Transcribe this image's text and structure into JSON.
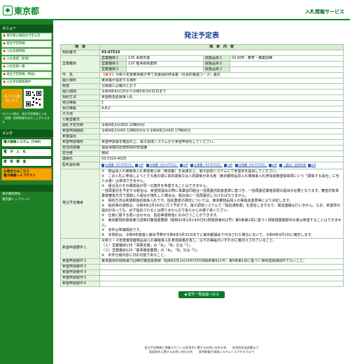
{
  "header": {
    "logo_glyph": "◆",
    "logo_text": "東京都",
    "service": "入札情報サービス"
  },
  "sidebar": {
    "menu_head": "メニュー",
    "items": [
      {
        "label": "東京都公報発注予定公告"
      },
      {
        "label": "発注予定情報"
      },
      {
        "label": "入札結果情報"
      },
      {
        "label": "入札情報（新規）"
      },
      {
        "label": "入札結果一覧"
      },
      {
        "label": "発注予定情報（物品）"
      },
      {
        "label": "入札参加資格要件"
      }
    ],
    "mobile_label": "モバイル版",
    "mobile_sub": "はこちら",
    "mobile_note": "モバイル版は、発注予定情報と入札（見積）結果情報を見ることができます",
    "link_head": "リンク",
    "banners": [
      {
        "label": "電子調達システム（TOP）"
      },
      {
        "label": "電　子　入　札"
      },
      {
        "label": "資　格　審　査"
      },
      {
        "label": "お問合せはこちら"
      }
    ],
    "banner_sub": "電子調達ヘルプデスク",
    "links": [
      "東京都財務局",
      "東京都トップページ"
    ]
  },
  "main": {
    "title": "発注予定表",
    "table_head": {
      "item": "項　目",
      "content": "項　目　内　容"
    },
    "rows": {
      "contract_no": {
        "label": "契約番号",
        "value": "03-07515"
      },
      "business_type": {
        "label": "営業種目",
        "entries": [
          {
            "label": "営業種目１",
            "value": "135 事務支援"
          },
          {
            "label": "営業種目２",
            "value": "120 催事関係業務"
          },
          {
            "label": "営業種目３",
            "value": ""
          }
        ],
        "categories": [
          {
            "label": "取扱品目１",
            "value": "02 研修・教育・職業訓練"
          },
          {
            "label": "取扱品目２",
            "value": ""
          },
          {
            "label": "取扱品目３",
            "value": ""
          }
        ]
      },
      "subject": {
        "label": "件　名",
        "tag": "【電子】",
        "value": "令和４年度東京都子育て支援員研修事業（社会的養護コース）委託"
      },
      "location": {
        "label": "履行場所",
        "value": "東京都が指定する場所"
      },
      "summary": {
        "label": "概要",
        "value": "仕様書に記載のとおり"
      },
      "period": {
        "label": "履行期間",
        "value": "令和4年4月1日から令和5年3月31日まで"
      },
      "method": {
        "label": "契約方法",
        "value": "希望制指名競争入札"
      },
      "dept": {
        "label": "発注等級",
        "value": "C"
      },
      "ranks": {
        "label": "受付等級",
        "value": "A,B,C"
      },
      "other": {
        "label": "その他",
        "value": ""
      },
      "announce": {
        "label": "公報登載日",
        "value": ""
      },
      "open_date": {
        "label": "開札予定日時",
        "value": "令和4年2月28日 10時00分"
      },
      "apply_period": {
        "label": "希望申請期間",
        "value": "令和4年2月4日 10時00分から令和4年2月9日 17時00分"
      },
      "apply_status": {
        "label": "希望提出",
        "value": ""
      },
      "apply_method": {
        "label": "希望申請場所",
        "value": "希望申請書を確認の上、電子調達システムから希望申請をしてください。"
      },
      "office": {
        "label": "担当局部課",
        "value": "福祉保健局総務部契約管理課"
      },
      "person": {
        "label": "担当者",
        "value": "徳岡"
      },
      "contact": {
        "label": "連絡先",
        "value": "03-5320-4025"
      },
      "attachments": {
        "label": "配布資料等",
        "files": [
          "仕様書（03-07515）",
          "pdf",
          "仕様書（03-07515）",
          "pdf",
          "仕様書（03-07515）",
          "pdf",
          "仕様書（03-07515）",
          "pdf",
          "（委託）契約約款",
          "pdf"
        ]
      },
      "remarks": {
        "label": "発注予定備考",
        "lines": [
          "①　物品買入れ等競争入札参加者心得（東京都）を承諾の上、電子調達システムにて希望票を提出してください。",
          "②　この入札に参加しようとする者の間に資本関係又は人的関係がある者（東京都物品買入れ等競争入札参加資格登録事項にいう「関係する会社」に当たる者）は参加できません。",
          "③　組合及びその構成員が同一の案件を希望することはできません。",
          "一括再委託を予定する組合は、希望票提出の際に事業協同組合一括再委託取扱基準に基づき、一括再委託業者調書の提出が必要となります。審査対象事業者審査方式で登録した組合が落札した場合は、組合員に一括再委託しなければなりません。",
          "※　契約方法は希望制指名競争入札です。指名業者の選定については、東京都物品買入れ等指名基準等により決定します。",
          "④　指名等の通知は、令和4年2月16日に行う予定です。電子調達システムで「指名通知書」を送信しますので、電話連絡は行いません。なお、希望票の提出があっても、必ず指名されるとは限りませんのであらかじめ御了承ください。",
          "⑤　仕様に関する問い合わせは、指名等通知後にのみ行うことができます。",
          "⑥　東京都契約関係暴力団等対策措置要綱（昭和62年1月14日付61財経庶第922号）第5条第1項に基づく排除措置期間中の者は希望することはできません。",
          "⑦　本件は単価契約です。",
          "⑧　本契約は、令和4年度歳入歳出予算が令和4年3月31日までに東京都議会で可決された場合において、令和4年4月1日に確定します。"
        ]
      },
      "requirement1": {
        "label": "希望申請要件１",
        "lines": [
          "令和３・４年度東京都物品買入れ等競争入札参加資格を有し、以下の等級のいずれかに格付けされていること。",
          "（１）営業種目135「事務支援」の「A」、「B」又は「C」",
          "（２）営業種目120「催事関係業務」の「A」、「B」又は「C」",
          "※　本件仕様内容に対応可能であること。"
        ]
      },
      "requirement2": {
        "label": "希望申請要件２",
        "value": "東京都契約関係暴力団等対策措置要綱（昭和62年1月14日付61財経庶第922号）第5条第1項に基づく排除措置期間中でないこと。"
      },
      "requirement3": {
        "label": "希望申請要件３",
        "value": ""
      },
      "requirement4": {
        "label": "希望申請要件４",
        "value": ""
      },
      "requirement5": {
        "label": "希望申請要件５",
        "value": ""
      },
      "requirement6": {
        "label": "希望申請要件６",
        "value": ""
      }
    },
    "back_button": "◀ 案件一覧画面へ戻る"
  },
  "footer": {
    "line1": "発注予定情報に掲載されている各案件に関するお問い合わせ先　　各契約担当部署まで",
    "line2": "画面操作に関するお問い合わせ先　　東京都電子調達システムヘルプデスクまで"
  }
}
